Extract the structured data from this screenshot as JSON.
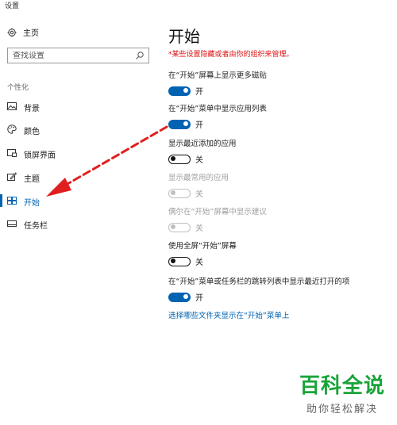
{
  "window": {
    "title": "设置"
  },
  "sidebar": {
    "home_label": "主页",
    "search_placeholder": "查找设置",
    "section_label": "个性化",
    "items": [
      {
        "label": "背景",
        "icon": "picture-icon"
      },
      {
        "label": "颜色",
        "icon": "palette-icon"
      },
      {
        "label": "锁屏界面",
        "icon": "lock-screen-icon"
      },
      {
        "label": "主题",
        "icon": "theme-icon"
      },
      {
        "label": "开始",
        "icon": "start-icon",
        "active": true
      },
      {
        "label": "任务栏",
        "icon": "taskbar-icon"
      }
    ]
  },
  "main": {
    "title": "开始",
    "warning": "*某些设置隐藏或者由你的组织来管理。",
    "settings": [
      {
        "label": "在“开始”屏幕上显示更多磁贴",
        "state": "开",
        "on": true,
        "disabled": false
      },
      {
        "label": "在“开始”菜单中显示应用列表",
        "state": "开",
        "on": true,
        "disabled": false
      },
      {
        "label": "显示最近添加的应用",
        "state": "关",
        "on": false,
        "disabled": false
      },
      {
        "label": "显示最常用的应用",
        "state": "关",
        "on": false,
        "disabled": true
      },
      {
        "label": "偶尔在“开始”屏幕中显示建议",
        "state": "关",
        "on": false,
        "disabled": true
      },
      {
        "label": "使用全屏“开始”屏幕",
        "state": "关",
        "on": false,
        "disabled": false
      },
      {
        "label": "在“开始”菜单或任务栏的跳转列表中显示最近打开的项",
        "state": "开",
        "on": true,
        "disabled": false
      }
    ],
    "link": "选择哪些文件夹显示在“开始”菜单上"
  },
  "colors": {
    "accent": "#0063b1",
    "warning": "#dd1111",
    "annotation_arrow": "#e02020",
    "watermark": "#1aa33a"
  },
  "watermark": {
    "main": "百科全说",
    "sub": "助你轻松解决"
  }
}
